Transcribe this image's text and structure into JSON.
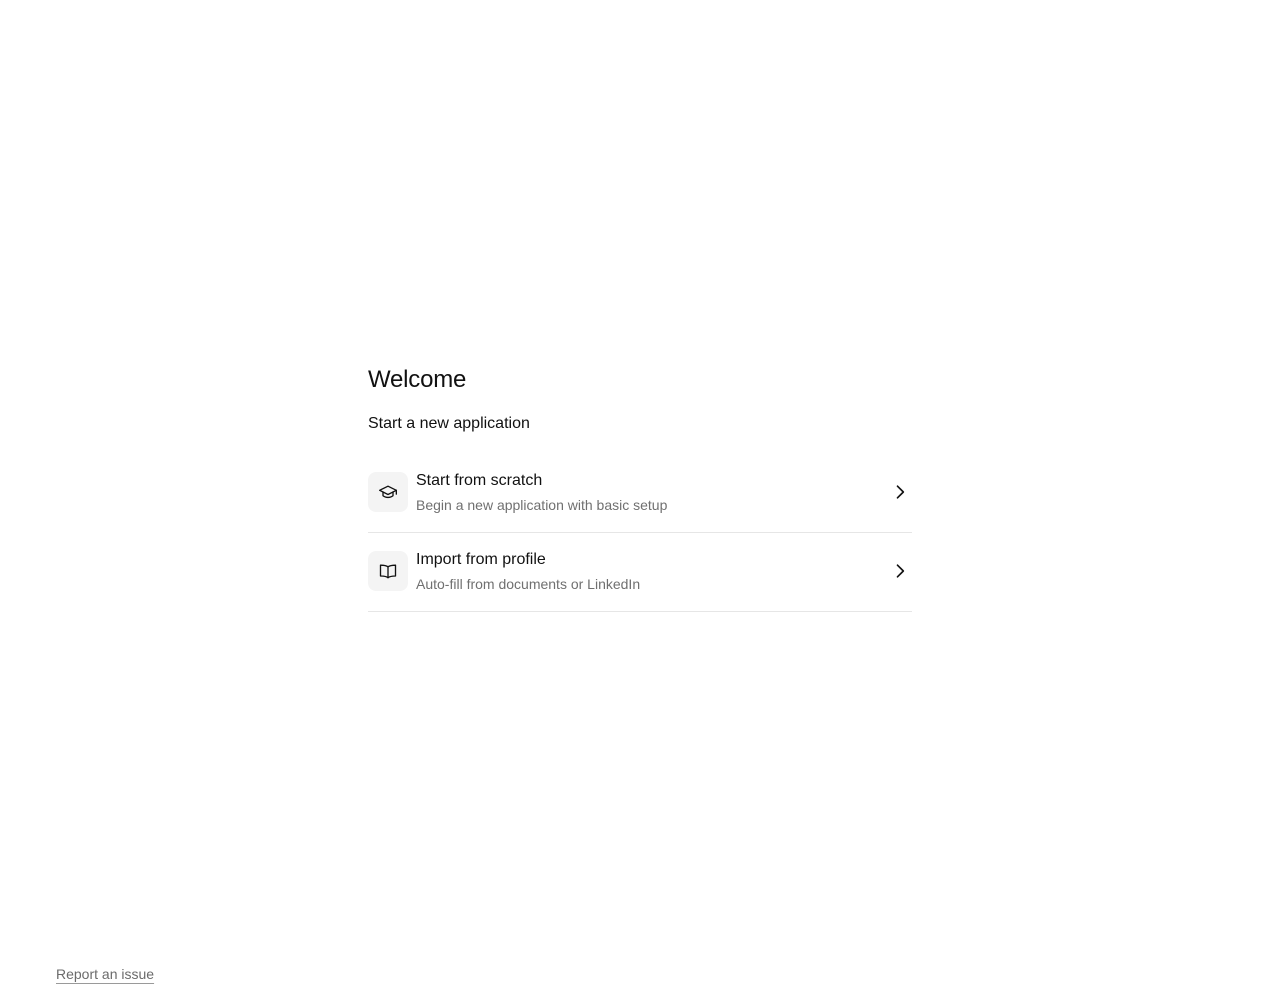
{
  "welcome": {
    "title": "Welcome",
    "subtitle": "Start a new application",
    "options": [
      {
        "title": "Start from scratch",
        "description": "Begin a new application with basic setup",
        "icon": "graduation-cap-icon"
      },
      {
        "title": "Import from profile",
        "description": "Auto-fill from documents or LinkedIn",
        "icon": "open-book-icon"
      }
    ]
  },
  "footer": {
    "report_label": "Report an issue"
  },
  "colors": {
    "text": "#111111",
    "muted_text": "#707070",
    "icon_bg": "#f4f4f4",
    "divider": "#e6e6e6"
  }
}
